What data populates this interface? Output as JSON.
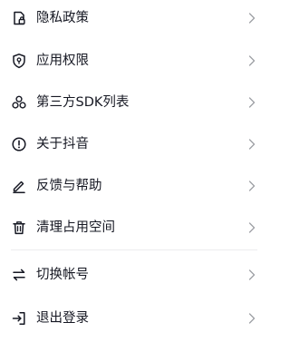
{
  "settings_menu": {
    "items": [
      {
        "label": "隐私政策",
        "icon": "privacy-policy-icon"
      },
      {
        "label": "应用权限",
        "icon": "shield-location-icon"
      },
      {
        "label": "第三方SDK列表",
        "icon": "sdk-cluster-icon"
      },
      {
        "label": "关于抖音",
        "icon": "info-exclamation-icon"
      },
      {
        "label": "反馈与帮助",
        "icon": "pencil-feedback-icon"
      },
      {
        "label": "清理占用空间",
        "icon": "trash-icon"
      }
    ],
    "account_items": [
      {
        "label": "切换帐号",
        "icon": "switch-arrows-icon"
      },
      {
        "label": "退出登录",
        "icon": "logout-icon"
      }
    ]
  }
}
